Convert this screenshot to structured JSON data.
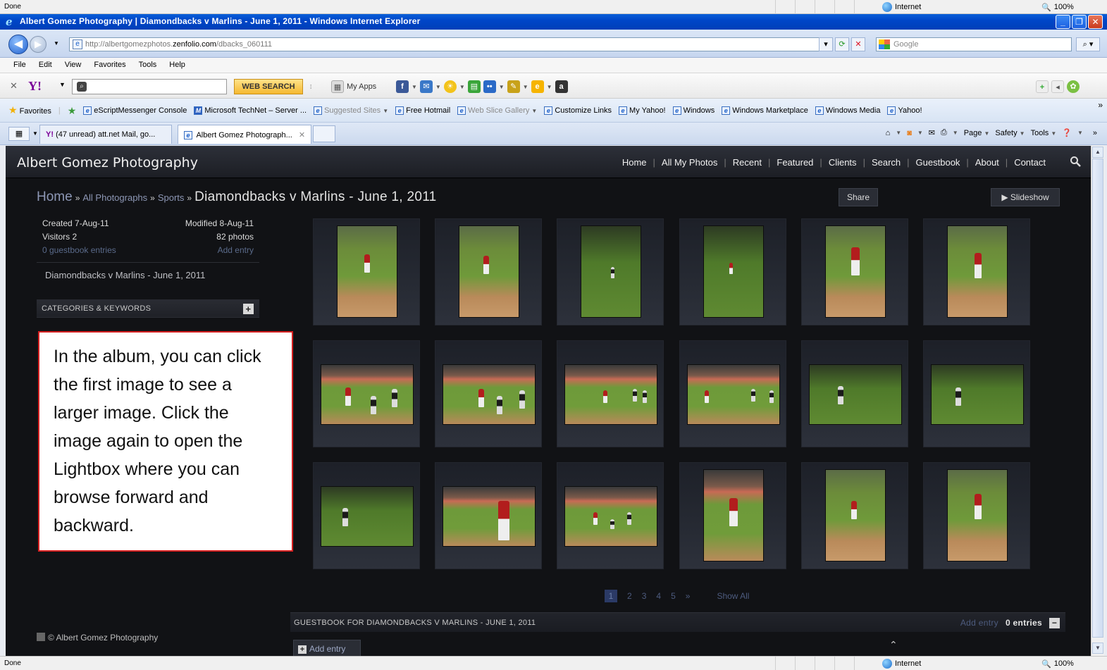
{
  "status_top": {
    "done": "Done",
    "zone": "Internet",
    "zoom": "100%"
  },
  "window": {
    "title": "Albert Gomez Photography | Diamondbacks v Marlins - June 1, 2011 - Windows Internet Explorer"
  },
  "address": {
    "url_prefix": "http://albertgomezphotos.",
    "url_domain": "zenfolio.com",
    "url_path": "/dbacks_060111",
    "search_placeholder": "Google"
  },
  "menu": [
    "File",
    "Edit",
    "View",
    "Favorites",
    "Tools",
    "Help"
  ],
  "yahoo": {
    "search_button": "WEB SEARCH",
    "my_apps": "My Apps"
  },
  "favorites": {
    "label": "Favorites",
    "links": [
      "eScriptMessenger Console",
      "Microsoft TechNet – Server ...",
      "Suggested Sites",
      "Free Hotmail",
      "Web Slice Gallery",
      "Customize Links",
      "My Yahoo!",
      "Windows",
      "Windows Marketplace",
      "Windows Media",
      "Yahoo!"
    ]
  },
  "tabs": [
    {
      "label": "(47 unread) att.net Mail, go..."
    },
    {
      "label": "Albert Gomez Photograph..."
    }
  ],
  "commandbar": {
    "page": "Page",
    "safety": "Safety",
    "tools": "Tools"
  },
  "site": {
    "name": "Albert Gomez Photography",
    "nav": [
      "Home",
      "All My Photos",
      "Recent",
      "Featured",
      "Clients",
      "Search",
      "Guestbook",
      "About",
      "Contact"
    ]
  },
  "breadcrumb": {
    "home": "Home",
    "sep": "»",
    "all": "All Photographs",
    "sports": "Sports",
    "current": "Diamondbacks v Marlins - June 1, 2011"
  },
  "buttons": {
    "share": "Share",
    "slideshow": "▶ Slideshow"
  },
  "album_meta": {
    "created": "Created 7-Aug-11",
    "modified": "Modified 8-Aug-11",
    "visitors": "Visitors 2",
    "photos": "82 photos",
    "guestbook_entries": "0 guestbook entries",
    "add_entry": "Add entry",
    "description": "Diamondbacks v Marlins - June 1, 2011",
    "categories_label": "CATEGORIES & KEYWORDS"
  },
  "callout": "In the album, you can click the first image to see a larger image. Click the image again to open the Lightbox where you can browse forward and backward.",
  "pager": {
    "pages": [
      "1",
      "2",
      "3",
      "4",
      "5"
    ],
    "next": "»",
    "show_all": "Show All"
  },
  "guestbook": {
    "title": "GUESTBOOK FOR DIAMONDBACKS V MARLINS - JUNE 1, 2011",
    "add_entry": "Add entry",
    "entries": "0 entries",
    "add_button": "Add entry"
  },
  "footer": {
    "copyright": "© Albert Gomez Photography"
  },
  "status_bottom": {
    "done": "Done",
    "zone": "Internet",
    "zoom": "100%"
  }
}
